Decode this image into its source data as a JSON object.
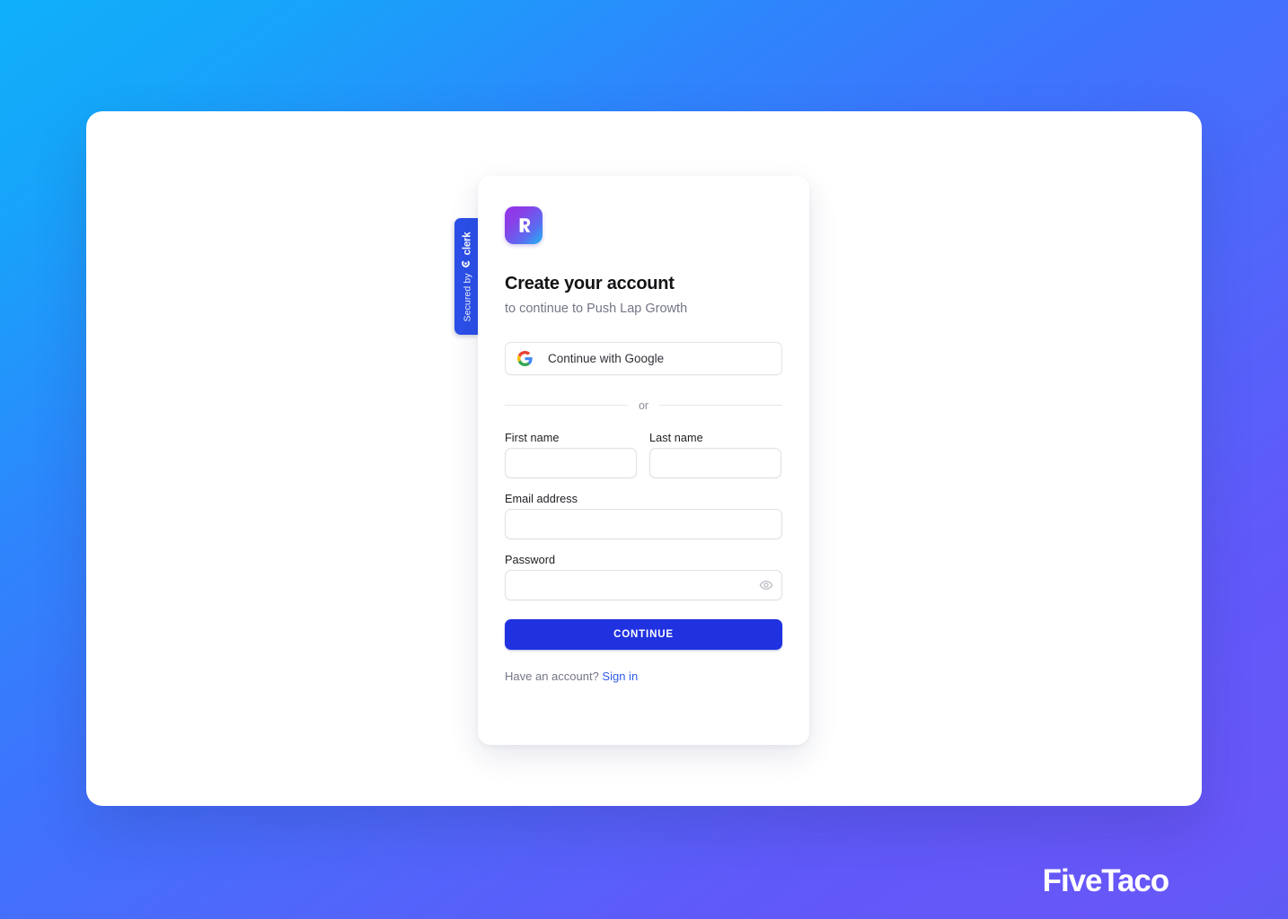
{
  "background": {
    "gradient_from": "#0FB0FB",
    "gradient_mid": "#3D74FC",
    "gradient_to": "#6757F8"
  },
  "security_badge": {
    "prefix_text": "Secured by",
    "brand_text": "clerk",
    "icon": "clerk-logo-icon",
    "color": "#2B4FE8"
  },
  "auth_card": {
    "logo": {
      "icon": "app-logo-icon",
      "gradient_from": "#9333EA",
      "gradient_to": "#22B6F3"
    },
    "title": "Create your account",
    "subtitle": "to continue to Push Lap Growth",
    "social": {
      "google_label": "Continue with Google",
      "google_icon": "google-g-icon"
    },
    "divider_label": "or",
    "fields": {
      "first_name": {
        "label": "First name",
        "value": "",
        "placeholder": ""
      },
      "last_name": {
        "label": "Last name",
        "value": "",
        "placeholder": ""
      },
      "email": {
        "label": "Email address",
        "value": "",
        "placeholder": ""
      },
      "password": {
        "label": "Password",
        "value": "",
        "placeholder": "",
        "reveal_icon": "eye-icon"
      }
    },
    "submit_label": "CONTINUE",
    "submit_color": "#2031E0",
    "footer": {
      "prompt": "Have an account?",
      "link_label": "Sign in",
      "link_color": "#2F5BE8"
    }
  },
  "watermark": {
    "text": "FiveTaco"
  }
}
